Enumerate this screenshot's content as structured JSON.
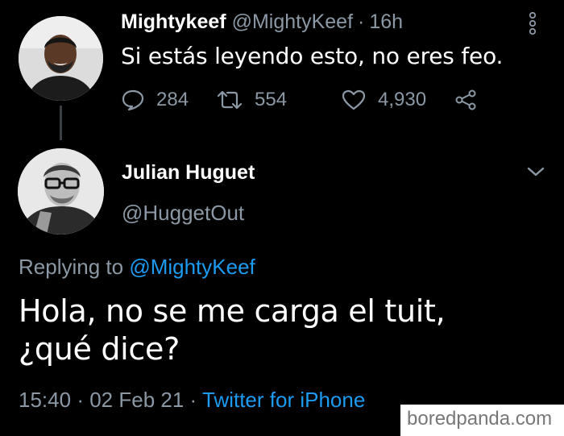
{
  "parent_tweet": {
    "display_name": "Mightykeef",
    "handle": "@MightyKeef",
    "separator": "·",
    "age": "16h",
    "text": "Si estás leyendo esto, no eres feo.",
    "reply_count": "284",
    "retweet_count": "554",
    "like_count": "4,930"
  },
  "reply_tweet": {
    "display_name": "Julian Huguet",
    "handle": "@HuggetOut",
    "replying_prefix": "Replying to",
    "replying_to": "@MightyKeef",
    "text_line1": "Hola, no se me carga el tuit,",
    "text_line2": "¿qué dice?",
    "time": "15:40",
    "date": "02 Feb 21",
    "separator": "·",
    "source": "Twitter for iPhone"
  },
  "watermark": "boredpanda.com",
  "colors": {
    "background": "#000000",
    "secondary_text": "#8b98a5",
    "link": "#1d9bf0"
  }
}
